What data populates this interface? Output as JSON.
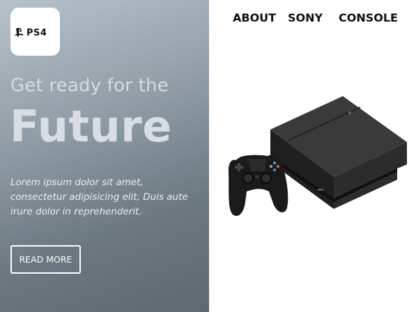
{
  "brand": {
    "logo_text": "PS4"
  },
  "nav": {
    "items": [
      {
        "label": "ABOUT"
      },
      {
        "label": "SONY"
      },
      {
        "label": "CONSOLE"
      }
    ]
  },
  "hero": {
    "tagline": "Get ready for the",
    "headline": "Future",
    "body": "Lorem ipsum dolor sit amet, consectetur adipisicing elit, Duis aute irure dolor in reprehenderit.",
    "cta_label": "READ MORE"
  },
  "colors": {
    "hero_gradient_start": "#b6c1cb",
    "hero_gradient_end": "#5d6870",
    "nav_text": "#111111",
    "console_body": "#2b2b2b"
  },
  "product_image": {
    "icon": "ps4-console-with-controller-image"
  }
}
